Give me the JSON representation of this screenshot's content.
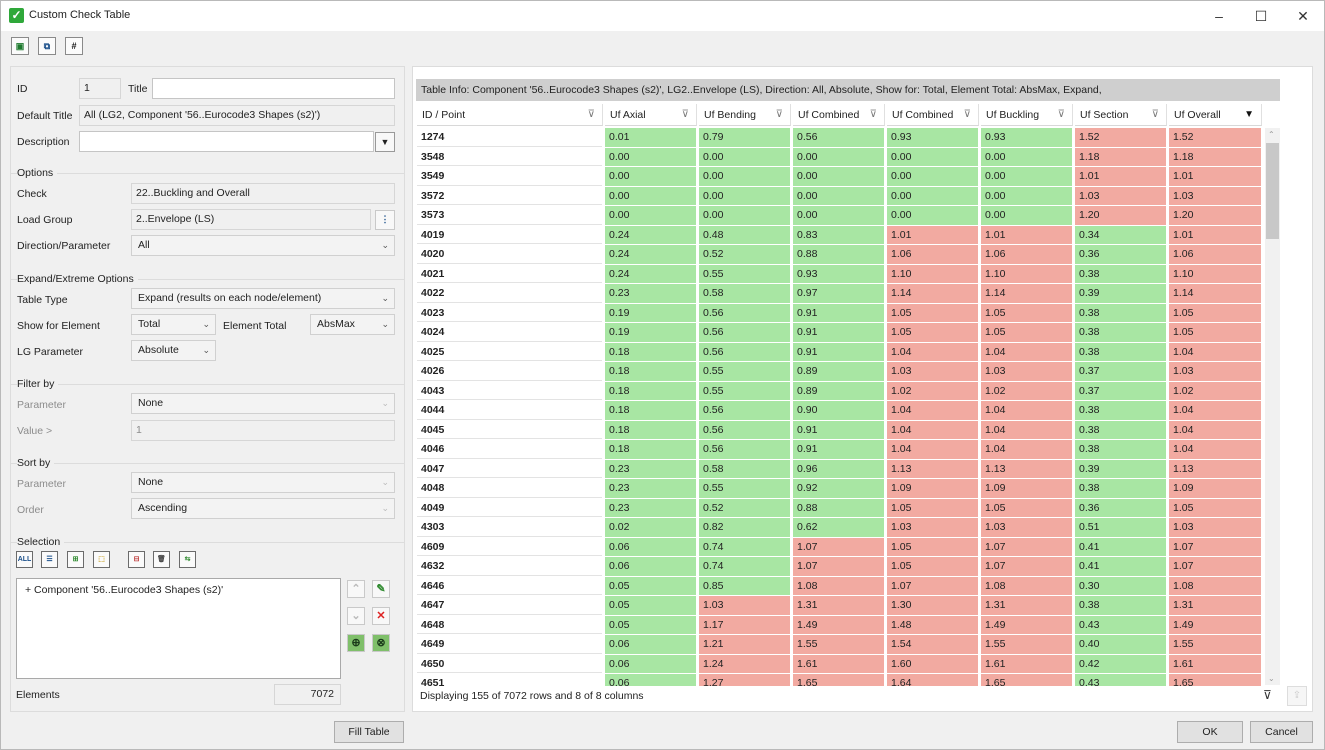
{
  "window": {
    "title": "Custom Check Table"
  },
  "form": {
    "id_label": "ID",
    "id_value": "1",
    "title_label": "Title",
    "title_value": "",
    "default_title_label": "Default Title",
    "default_title_value": "All (LG2, Component '56..Eurocode3 Shapes (s2)')",
    "description_label": "Description",
    "description_value": ""
  },
  "options": {
    "section": "Options",
    "check_label": "Check",
    "check_value": "22..Buckling and Overall",
    "load_group_label": "Load Group",
    "load_group_value": "2..Envelope (LS)",
    "direction_label": "Direction/Parameter",
    "direction_value": "All"
  },
  "expand": {
    "section": "Expand/Extreme Options",
    "table_type_label": "Table Type",
    "table_type_value": "Expand (results on each node/element)",
    "show_for_element_label": "Show for Element",
    "show_for_element_value": "Total",
    "element_total_label": "Element Total",
    "element_total_value": "AbsMax",
    "lg_parameter_label": "LG Parameter",
    "lg_parameter_value": "Absolute"
  },
  "filter": {
    "section": "Filter by",
    "parameter_label": "Parameter",
    "parameter_value": "None",
    "value_label": "Value >",
    "value_value": "1"
  },
  "sort": {
    "section": "Sort by",
    "parameter_label": "Parameter",
    "parameter_value": "None",
    "order_label": "Order",
    "order_value": "Ascending"
  },
  "selection": {
    "section": "Selection",
    "all_label": "ALL",
    "items": [
      "+ Component '56..Eurocode3 Shapes (s2)'"
    ]
  },
  "elements": {
    "label": "Elements",
    "value": "7072"
  },
  "buttons": {
    "fill_table": "Fill Table",
    "ok": "OK",
    "cancel": "Cancel"
  },
  "table": {
    "info": "Table Info: Component '56..Eurocode3 Shapes (s2)', LG2..Envelope (LS), Direction: All, Absolute, Show for: Total, Element Total: AbsMax, Expand,",
    "columns": [
      "ID / Point",
      "Uf Axial",
      "Uf Bending",
      "Uf Combined",
      "Uf Combined",
      "Uf Buckling",
      "Uf Section",
      "Uf Overall"
    ],
    "rows": [
      [
        "1274",
        "0.01",
        "0.79",
        "0.56",
        "0.93",
        "0.93",
        "1.52",
        "1.52"
      ],
      [
        "3548",
        "0.00",
        "0.00",
        "0.00",
        "0.00",
        "0.00",
        "1.18",
        "1.18"
      ],
      [
        "3549",
        "0.00",
        "0.00",
        "0.00",
        "0.00",
        "0.00",
        "1.01",
        "1.01"
      ],
      [
        "3572",
        "0.00",
        "0.00",
        "0.00",
        "0.00",
        "0.00",
        "1.03",
        "1.03"
      ],
      [
        "3573",
        "0.00",
        "0.00",
        "0.00",
        "0.00",
        "0.00",
        "1.20",
        "1.20"
      ],
      [
        "4019",
        "0.24",
        "0.48",
        "0.83",
        "1.01",
        "1.01",
        "0.34",
        "1.01"
      ],
      [
        "4020",
        "0.24",
        "0.52",
        "0.88",
        "1.06",
        "1.06",
        "0.36",
        "1.06"
      ],
      [
        "4021",
        "0.24",
        "0.55",
        "0.93",
        "1.10",
        "1.10",
        "0.38",
        "1.10"
      ],
      [
        "4022",
        "0.23",
        "0.58",
        "0.97",
        "1.14",
        "1.14",
        "0.39",
        "1.14"
      ],
      [
        "4023",
        "0.19",
        "0.56",
        "0.91",
        "1.05",
        "1.05",
        "0.38",
        "1.05"
      ],
      [
        "4024",
        "0.19",
        "0.56",
        "0.91",
        "1.05",
        "1.05",
        "0.38",
        "1.05"
      ],
      [
        "4025",
        "0.18",
        "0.56",
        "0.91",
        "1.04",
        "1.04",
        "0.38",
        "1.04"
      ],
      [
        "4026",
        "0.18",
        "0.55",
        "0.89",
        "1.03",
        "1.03",
        "0.37",
        "1.03"
      ],
      [
        "4043",
        "0.18",
        "0.55",
        "0.89",
        "1.02",
        "1.02",
        "0.37",
        "1.02"
      ],
      [
        "4044",
        "0.18",
        "0.56",
        "0.90",
        "1.04",
        "1.04",
        "0.38",
        "1.04"
      ],
      [
        "4045",
        "0.18",
        "0.56",
        "0.91",
        "1.04",
        "1.04",
        "0.38",
        "1.04"
      ],
      [
        "4046",
        "0.18",
        "0.56",
        "0.91",
        "1.04",
        "1.04",
        "0.38",
        "1.04"
      ],
      [
        "4047",
        "0.23",
        "0.58",
        "0.96",
        "1.13",
        "1.13",
        "0.39",
        "1.13"
      ],
      [
        "4048",
        "0.23",
        "0.55",
        "0.92",
        "1.09",
        "1.09",
        "0.38",
        "1.09"
      ],
      [
        "4049",
        "0.23",
        "0.52",
        "0.88",
        "1.05",
        "1.05",
        "0.36",
        "1.05"
      ],
      [
        "4303",
        "0.02",
        "0.82",
        "0.62",
        "1.03",
        "1.03",
        "0.51",
        "1.03"
      ],
      [
        "4609",
        "0.06",
        "0.74",
        "1.07",
        "1.05",
        "1.07",
        "0.41",
        "1.07"
      ],
      [
        "4632",
        "0.06",
        "0.74",
        "1.07",
        "1.05",
        "1.07",
        "0.41",
        "1.07"
      ],
      [
        "4646",
        "0.05",
        "0.85",
        "1.08",
        "1.07",
        "1.08",
        "0.30",
        "1.08"
      ],
      [
        "4647",
        "0.05",
        "1.03",
        "1.31",
        "1.30",
        "1.31",
        "0.38",
        "1.31"
      ],
      [
        "4648",
        "0.05",
        "1.17",
        "1.49",
        "1.48",
        "1.49",
        "0.43",
        "1.49"
      ],
      [
        "4649",
        "0.06",
        "1.21",
        "1.55",
        "1.54",
        "1.55",
        "0.40",
        "1.55"
      ],
      [
        "4650",
        "0.06",
        "1.24",
        "1.61",
        "1.60",
        "1.61",
        "0.42",
        "1.61"
      ],
      [
        "4651",
        "0.06",
        "1.27",
        "1.65",
        "1.64",
        "1.65",
        "0.43",
        "1.65"
      ]
    ],
    "status": "Displaying 155 of 7072 rows and 8 of 8 columns"
  },
  "colors": {
    "pass": "#a8e6a3",
    "fail": "#f2aaa1"
  }
}
